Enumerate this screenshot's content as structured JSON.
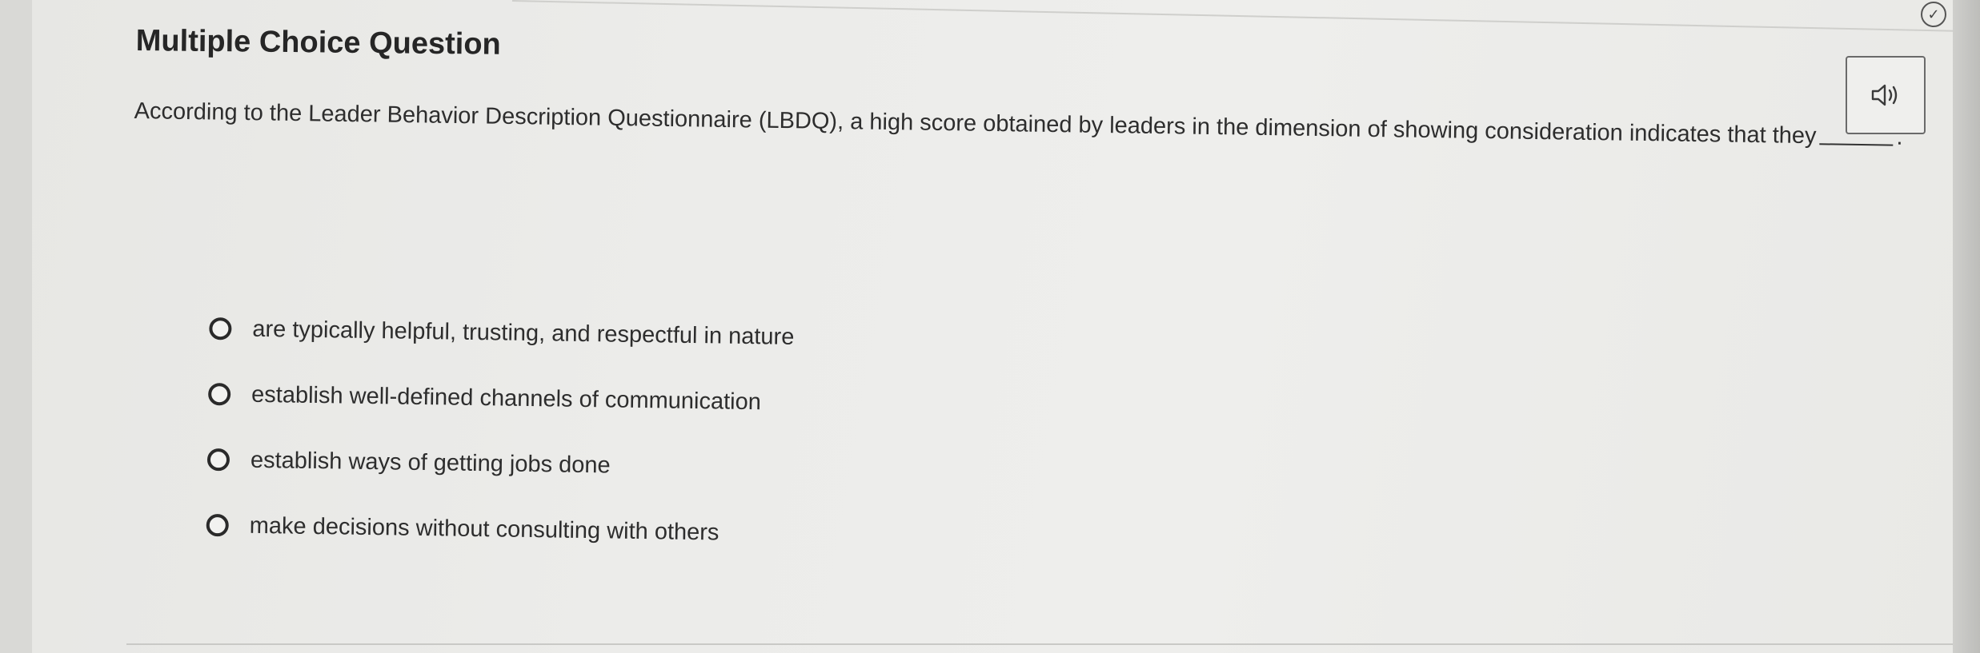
{
  "question": {
    "title": "Multiple Choice Question",
    "prompt_before_blank": "According to the Leader Behavior Description Questionnaire (LBDQ), a high score obtained by leaders in the dimension of showing consideration indicates that they",
    "prompt_after_blank": "."
  },
  "choices": [
    {
      "label": "are typically helpful, trusting, and respectful in nature"
    },
    {
      "label": "establish well-defined channels of communication"
    },
    {
      "label": "establish ways of getting jobs done"
    },
    {
      "label": "make decisions without consulting with others"
    }
  ],
  "icons": {
    "audio": "speaker-icon",
    "status": "check-circle-icon"
  },
  "colors": {
    "text": "#2b2b2b",
    "page": "#ececea",
    "border": "#6a6a6a"
  }
}
